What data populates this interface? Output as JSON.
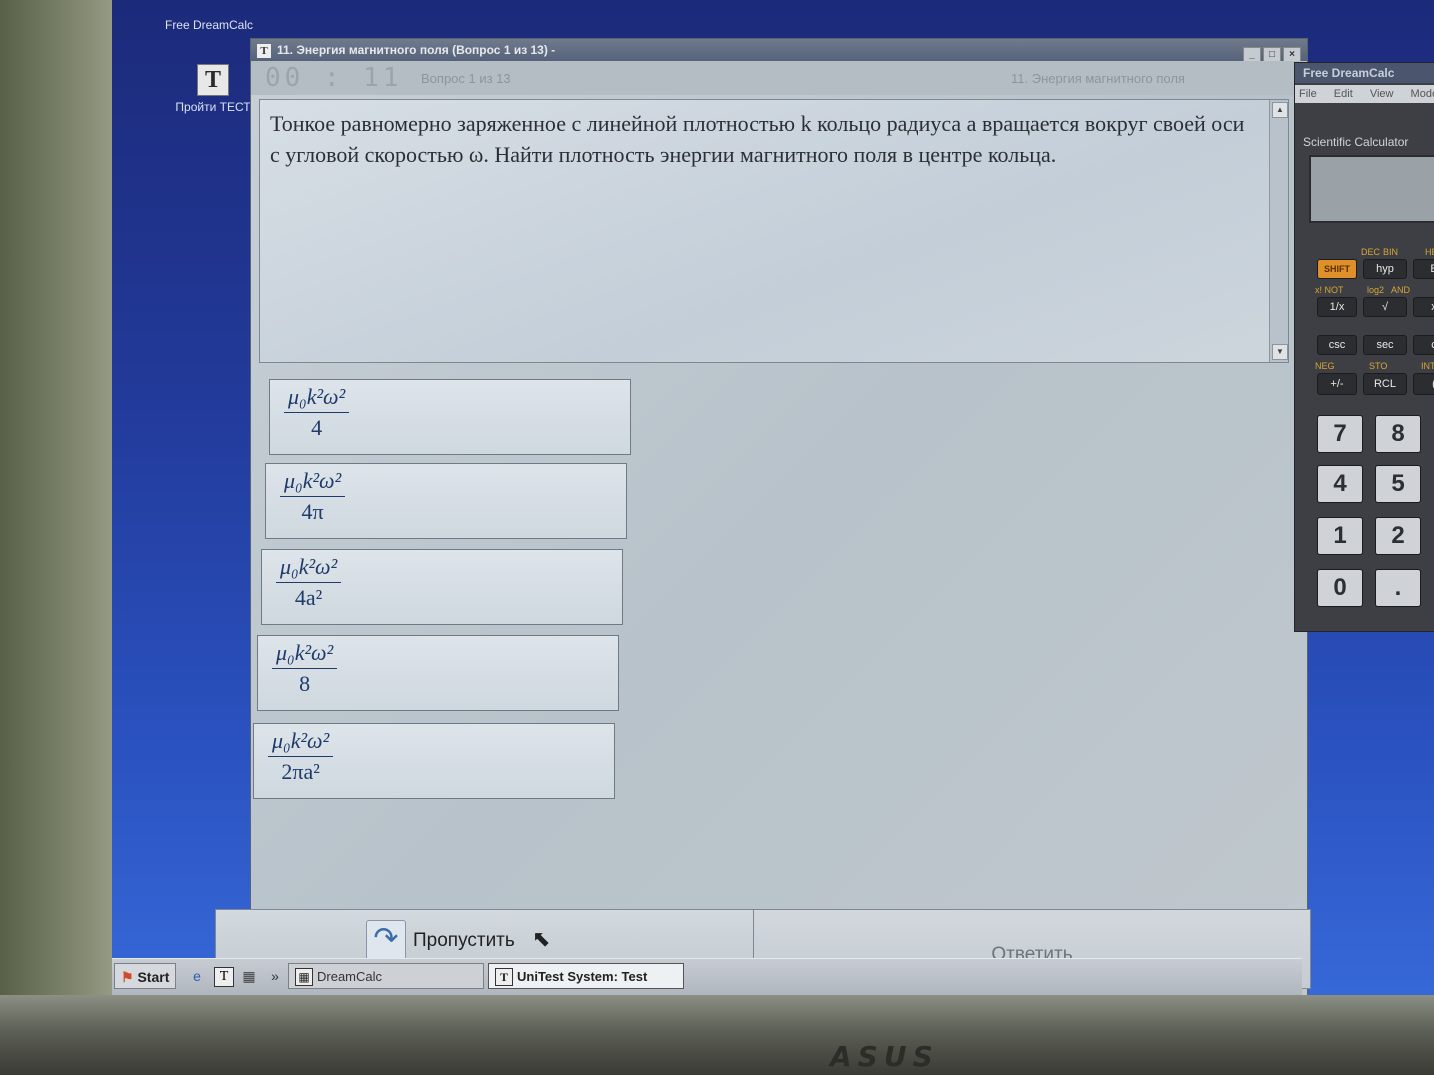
{
  "desktop": {
    "icons": [
      {
        "label": "Free DreamCalc"
      },
      {
        "label": "Пройти ТЕСТ",
        "glyph": "T"
      }
    ]
  },
  "window": {
    "title": "11. Энергия магнитного поля (Вопрос 1 из 13) -",
    "toolbar": {
      "timer": "00 : 11",
      "question_counter": "Вопрос 1 из 13",
      "topic": "11. Энергия магнитного поля"
    },
    "question": {
      "text": "Тонкое равномерно заряженное с линейной плотностью k кольцо радиуса a вращается вокруг своей оси с угловой скоростью ω. Найти плотность энергии магнитного поля в центре кольца."
    },
    "answers": [
      {
        "numerator": "μ₀k²ω²",
        "denominator": "4"
      },
      {
        "numerator": "μ₀k²ω²",
        "denominator": "4π"
      },
      {
        "numerator": "μ₀k²ω²",
        "denominator": "4a²"
      },
      {
        "numerator": "μ₀k²ω²",
        "denominator": "8"
      },
      {
        "numerator": "μ₀k²ω²",
        "denominator": "2πa²"
      }
    ],
    "buttons": {
      "skip": "Пропустить",
      "answer": "Ответить"
    }
  },
  "calculator": {
    "title": "Free DreamCalc",
    "menu": [
      "File",
      "Edit",
      "View",
      "Mode"
    ],
    "label": "Scientific Calculator",
    "keys_row1": [
      "SHIFT",
      "hyp",
      "E"
    ],
    "keys_row2": [
      "1/x",
      "√",
      "x"
    ],
    "keys_row3": [
      "csc",
      "sec",
      "c"
    ],
    "keys_row4": [
      "+/-",
      "RCL",
      "("
    ],
    "digits": [
      "7",
      "8",
      "4",
      "5",
      "1",
      "2",
      "0",
      "."
    ],
    "sub_labels": [
      "DEC",
      "BIN",
      "HEX",
      "x! NOT",
      "log2",
      "AND",
      "STO",
      "INT",
      "NEG"
    ]
  },
  "taskbar": {
    "start": "Start",
    "tasks": [
      {
        "label": "DreamCalc"
      },
      {
        "label": "UniTest System: Test"
      }
    ]
  }
}
